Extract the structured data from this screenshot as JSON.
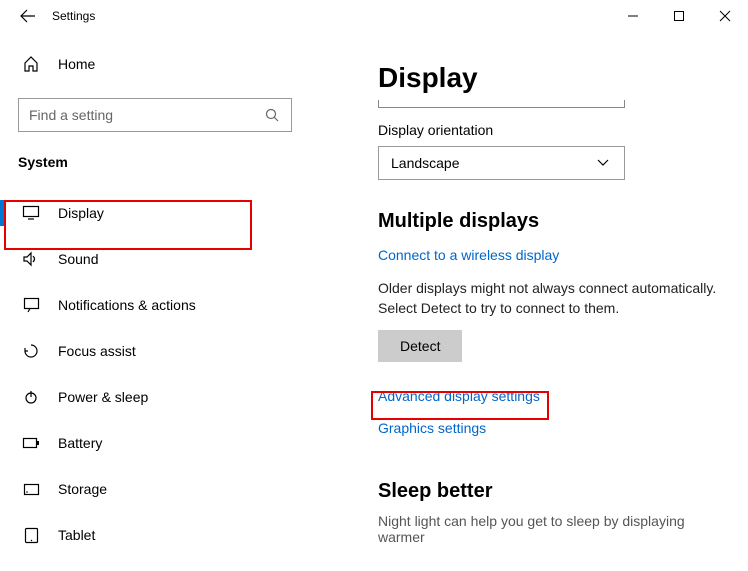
{
  "titlebar": {
    "title": "Settings"
  },
  "sidebar": {
    "home": "Home",
    "search_placeholder": "Find a setting",
    "section": "System",
    "items": [
      {
        "label": "Display"
      },
      {
        "label": "Sound"
      },
      {
        "label": "Notifications & actions"
      },
      {
        "label": "Focus assist"
      },
      {
        "label": "Power & sleep"
      },
      {
        "label": "Battery"
      },
      {
        "label": "Storage"
      },
      {
        "label": "Tablet"
      }
    ]
  },
  "content": {
    "page_title": "Display",
    "orientation_label": "Display orientation",
    "orientation_value": "Landscape",
    "multiple_heading": "Multiple displays",
    "wireless_link": "Connect to a wireless display",
    "older_text": "Older displays might not always connect automatically. Select Detect to try to connect to them.",
    "detect_btn": "Detect",
    "advanced_link": "Advanced display settings",
    "graphics_link": "Graphics settings",
    "sleep_heading": "Sleep better",
    "sleep_desc": "Night light can help you get to sleep by displaying warmer"
  }
}
